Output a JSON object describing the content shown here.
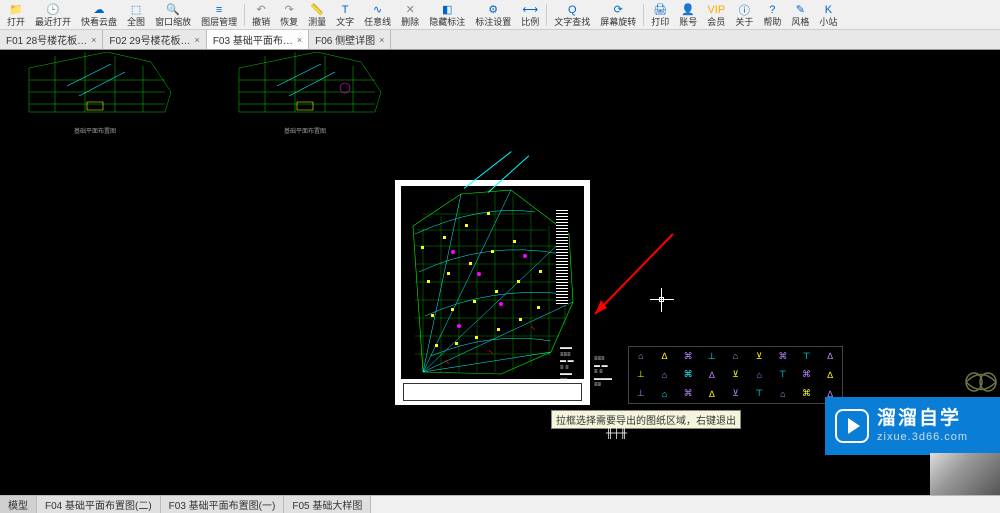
{
  "toolbar": [
    {
      "name": "open",
      "label": "打开",
      "icon": "📁",
      "cls": "icon-blue"
    },
    {
      "name": "recent",
      "label": "最近打开",
      "icon": "🕒",
      "cls": "icon-green"
    },
    {
      "name": "quick-cloud",
      "label": "快看云盘",
      "icon": "☁",
      "cls": "icon-blue"
    },
    {
      "name": "full-view",
      "label": "全图",
      "icon": "⬚",
      "cls": "icon-blue"
    },
    {
      "name": "window-zoom",
      "label": "窗口缩放",
      "icon": "🔍",
      "cls": "icon-blue"
    },
    {
      "name": "layer-mgr",
      "label": "图层管理",
      "icon": "≡",
      "cls": "icon-blue"
    },
    {
      "sep": true
    },
    {
      "name": "undo",
      "label": "撤销",
      "icon": "↶",
      "cls": "icon-gray"
    },
    {
      "name": "redo",
      "label": "恢复",
      "icon": "↷",
      "cls": "icon-gray"
    },
    {
      "name": "measure",
      "label": "测量",
      "icon": "📏",
      "cls": "icon-blue"
    },
    {
      "name": "text",
      "label": "文字",
      "icon": "T",
      "cls": "icon-blue"
    },
    {
      "name": "polyline",
      "label": "任意线",
      "icon": "∿",
      "cls": "icon-blue"
    },
    {
      "name": "delete",
      "label": "删除",
      "icon": "✕",
      "cls": "icon-gray"
    },
    {
      "name": "hide-annot",
      "label": "隐藏标注",
      "icon": "◧",
      "cls": "icon-blue"
    },
    {
      "name": "annot-set",
      "label": "标注设置",
      "icon": "⚙",
      "cls": "icon-blue"
    },
    {
      "name": "scale",
      "label": "比例",
      "icon": "⟷",
      "cls": "icon-blue"
    },
    {
      "sep": true
    },
    {
      "name": "find-text",
      "label": "文字查找",
      "icon": "Q",
      "cls": "icon-blue"
    },
    {
      "name": "rotate",
      "label": "屏幕旋转",
      "icon": "⟳",
      "cls": "icon-blue"
    },
    {
      "sep": true
    },
    {
      "name": "print",
      "label": "打印",
      "icon": "🖨",
      "cls": "icon-blue"
    },
    {
      "name": "account",
      "label": "账号",
      "icon": "👤",
      "cls": "icon-blue"
    },
    {
      "name": "vip",
      "label": "会员",
      "icon": "VIP",
      "cls": "icon-gold"
    },
    {
      "name": "about",
      "label": "关于",
      "icon": "ⓘ",
      "cls": "icon-blue"
    },
    {
      "name": "help",
      "label": "帮助",
      "icon": "?",
      "cls": "icon-blue"
    },
    {
      "name": "style",
      "label": "风格",
      "icon": "✎",
      "cls": "icon-blue"
    },
    {
      "name": "site",
      "label": "小站",
      "icon": "K",
      "cls": "icon-blue"
    }
  ],
  "tabs": [
    {
      "label": "F01 28号楼花板…",
      "active": false,
      "closable": true
    },
    {
      "label": "F02 29号楼花板…",
      "active": false,
      "closable": true
    },
    {
      "label": "F03 基础平面布…",
      "active": true,
      "closable": true
    },
    {
      "label": "F06 侧壁详图",
      "active": false,
      "closable": true
    }
  ],
  "tooltip_text": "拉框选择需要导出的图纸区域，右键退出",
  "bottom_tabs": [
    {
      "label": "模型"
    },
    {
      "label": "F04 基础平面布置图(二)"
    },
    {
      "label": "F03 基础平面布置图(一)"
    },
    {
      "label": "F05 基础大样图"
    }
  ],
  "watermark": {
    "title": "溜溜自学",
    "sub": "zixue.3d66.com"
  },
  "colors": {
    "accent": "#0a7dd6",
    "cad_green": "#00ff00",
    "cad_cyan": "#00ffff",
    "cad_yellow": "#ffff00",
    "cad_magenta": "#ff00ff",
    "cad_red": "#ff0000"
  }
}
